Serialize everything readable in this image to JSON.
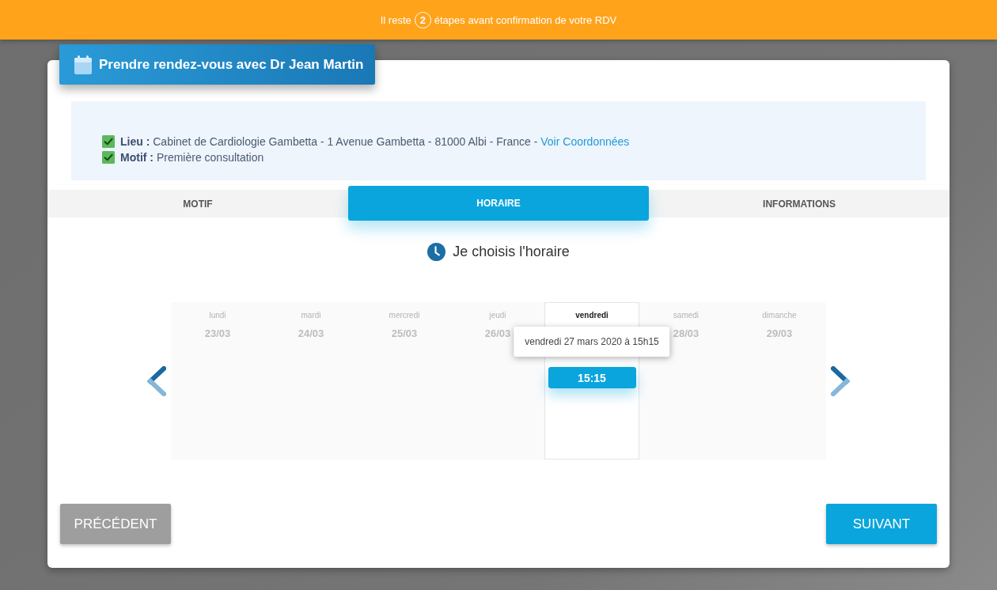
{
  "progress_banner": {
    "prefix": "Il reste",
    "count": "2",
    "suffix": "étapes avant confirmation de votre RDV"
  },
  "card": {
    "title": "Prendre rendez-vous avec Dr Jean Martin"
  },
  "summary": [
    {
      "label": "Lieu :",
      "value": "Cabinet de Cardiologie Gambetta - 1 Avenue Gambetta - 81000 Albi - France -",
      "link": "Voir Coordonnées",
      "checked": true
    },
    {
      "label": "Motif :",
      "value": "Première consultation",
      "checked": true
    }
  ],
  "tabs": [
    {
      "label": "MOTIF",
      "selected": false
    },
    {
      "label": "HORAIRE",
      "selected": true
    },
    {
      "label": "INFORMATIONS",
      "selected": false
    }
  ],
  "section_title": "Je choisis l'horaire",
  "calendar": {
    "days": [
      {
        "name": "lundi",
        "date": "23/03",
        "selected": false
      },
      {
        "name": "mardi",
        "date": "24/03",
        "selected": false
      },
      {
        "name": "mercredi",
        "date": "25/03",
        "selected": false
      },
      {
        "name": "jeudi",
        "date": "26/03",
        "selected": false
      },
      {
        "name": "vendredi",
        "selected": true,
        "slots": [
          {
            "time": "15:15",
            "selected": true,
            "tooltip": "vendredi 27 mars 2020 à 15h15"
          }
        ]
      },
      {
        "name": "samedi",
        "date": "28/03",
        "selected": false
      },
      {
        "name": "dimanche",
        "date": "29/03",
        "selected": false
      }
    ]
  },
  "buttons": [
    {
      "label": "PRÉCÉDENT",
      "kind": "secondary"
    },
    {
      "label": "SUIVANT",
      "kind": "primary"
    }
  ]
}
